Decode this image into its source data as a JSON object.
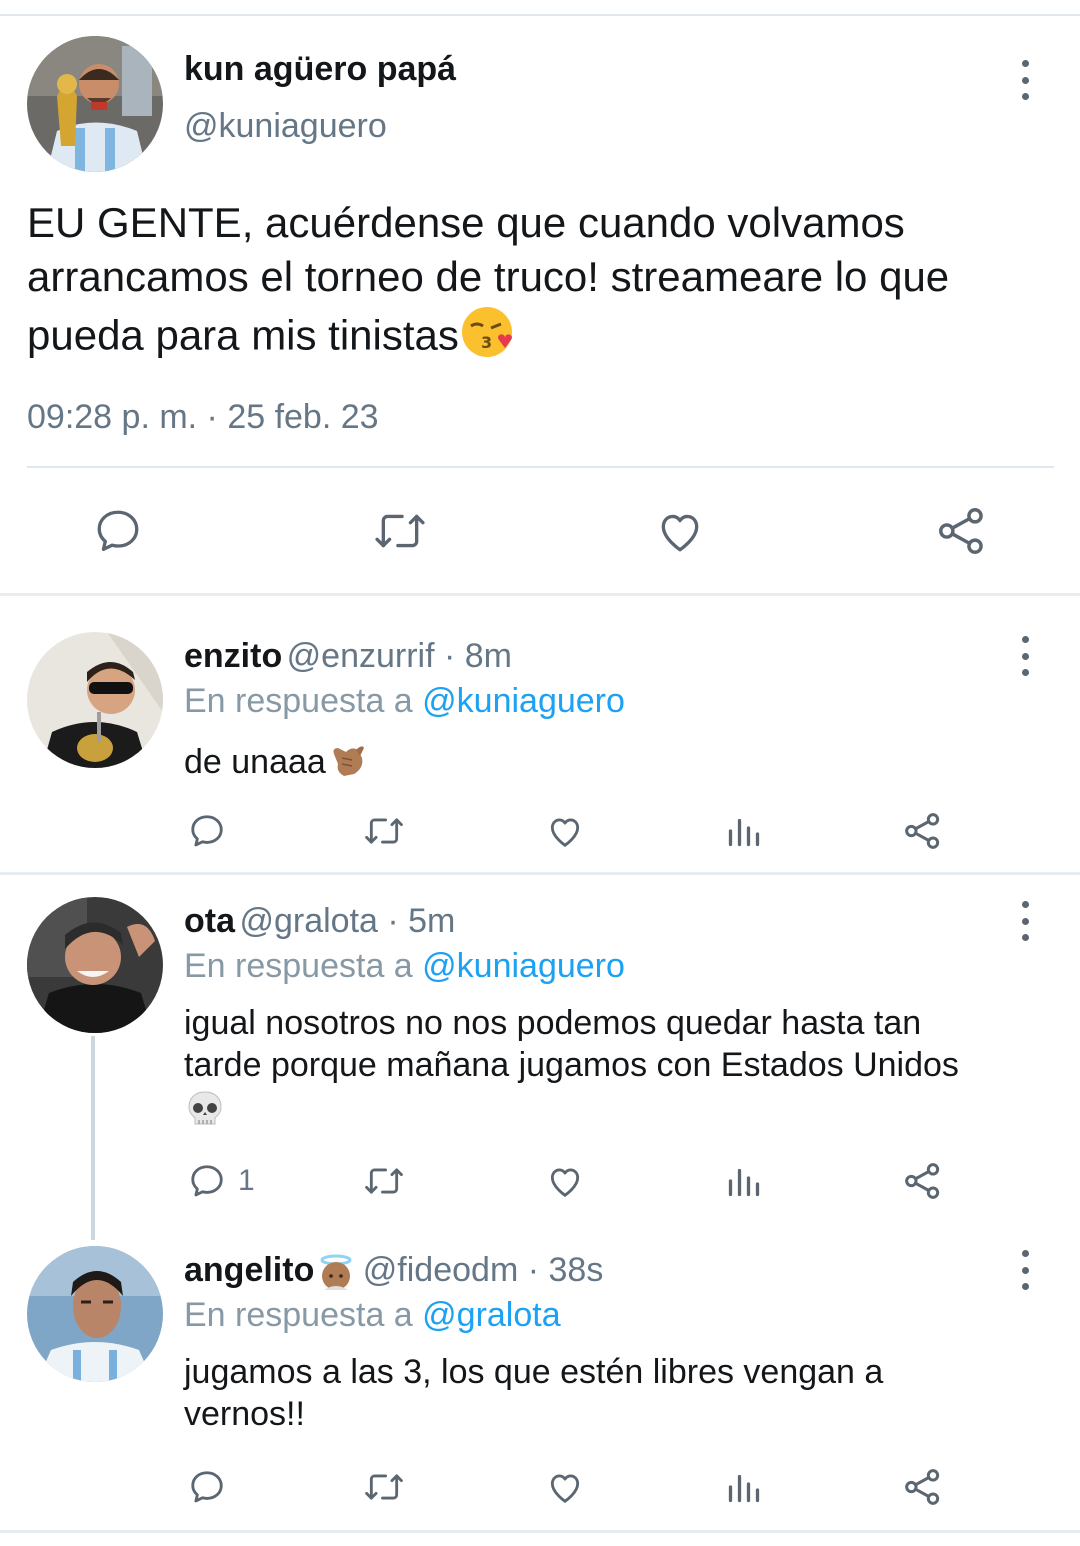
{
  "tweet": {
    "name": "kun agüero papá",
    "handle": "@kuniaguero",
    "text": "EU GENTE, acuérdense que cuando volvamos arrancamos el torneo de truco! streameare lo que pueda para mis tinistas",
    "emoji": "kissing-heart-emoji",
    "timestamp": "09:28 p. m. · 25 feb. 23",
    "actions": [
      "reply-icon",
      "retweet-icon",
      "like-icon",
      "share-icon"
    ]
  },
  "replies": [
    {
      "name": "enzito",
      "handle": "@enzurrif",
      "time": " · 8m",
      "reply_prefix": "En respuesta a ",
      "reply_to": "@kuniaguero",
      "text": "de unaaa",
      "emoji": "call-me-hand-emoji",
      "reply_count": ""
    },
    {
      "name": "ota",
      "handle": "@gralota",
      "time": " · 5m",
      "reply_prefix": "En respuesta a ",
      "reply_to": "@kuniaguero",
      "text_line1": "igual nosotros no nos podemos quedar hasta tan",
      "text_line2": "tarde porque mañana jugamos con Estados Unidos",
      "emoji": "skull-emoji",
      "reply_count": "1"
    },
    {
      "name": "angelito",
      "name_emoji": "angel-emoji",
      "handle": "@fideodm",
      "time": " · 38s",
      "reply_prefix": "En respuesta a ",
      "reply_to": "@gralota",
      "text_line1": "jugamos a las 3, los que estén libres vengan a",
      "text_line2": "vernos!!",
      "reply_count": ""
    }
  ],
  "colors": {
    "accent": "#1da1f2",
    "icon": "#5b6670",
    "secondary_text": "#657786",
    "divider": "#e1e8ed"
  }
}
